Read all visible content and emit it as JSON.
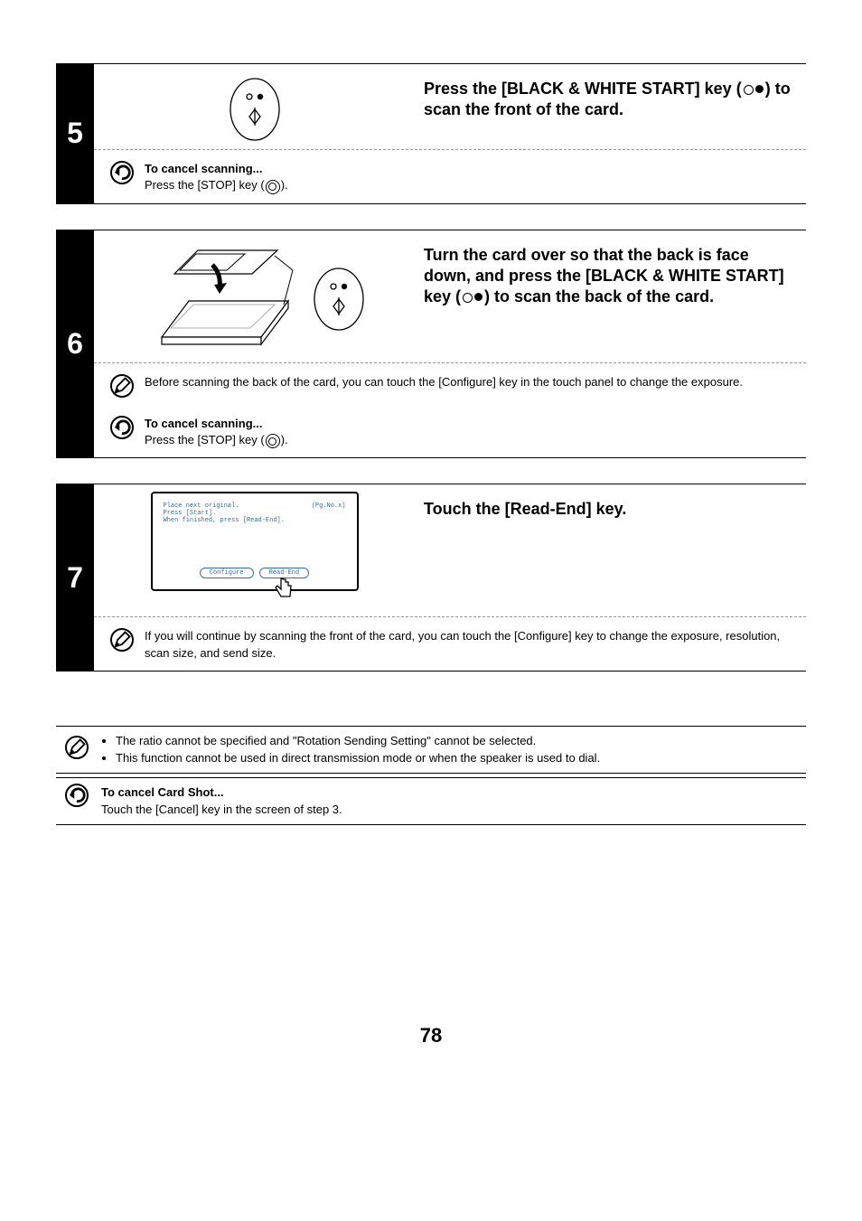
{
  "steps": {
    "5": {
      "num": "5",
      "title_a": "Press the [BLACK & WHITE START] key (",
      "title_b": ") to scan the front of the card.",
      "cancel_heading": "To cancel scanning...",
      "cancel_text_a": "Press the [STOP] key (",
      "cancel_text_b": ")."
    },
    "6": {
      "num": "6",
      "title_a": "Turn the card over so that the back is face down, and press the [BLACK & WHITE START] key (",
      "title_b": ") to scan the back of the card.",
      "note_text": "Before scanning the back of the card, you can touch the [Configure] key in the touch panel to change the exposure.",
      "cancel_heading": "To cancel scanning...",
      "cancel_text_a": "Press the [STOP] key (",
      "cancel_text_b": ")."
    },
    "7": {
      "num": "7",
      "title": "Touch the [Read-End] key.",
      "panel_line1": "Place next original.",
      "panel_pg": "(Pg.No.x)",
      "panel_line2": "Press [Start].",
      "panel_line3": "When finished, press [Read-End].",
      "btn_configure": "Configure",
      "btn_readend": "Read-End",
      "note_text": "If you will continue by scanning the front of the card, you can touch the [Configure] key to change the exposure, resolution, scan size, and send size."
    }
  },
  "footer": {
    "info_bullet1": "The ratio cannot be specified and \"Rotation Sending Setting\" cannot be selected.",
    "info_bullet2": "This function cannot be used in direct transmission mode or when the speaker is used to dial.",
    "cancel_heading": "To cancel Card Shot...",
    "cancel_text": "Touch the [Cancel] key in the screen of step 3."
  },
  "page_number": "78"
}
